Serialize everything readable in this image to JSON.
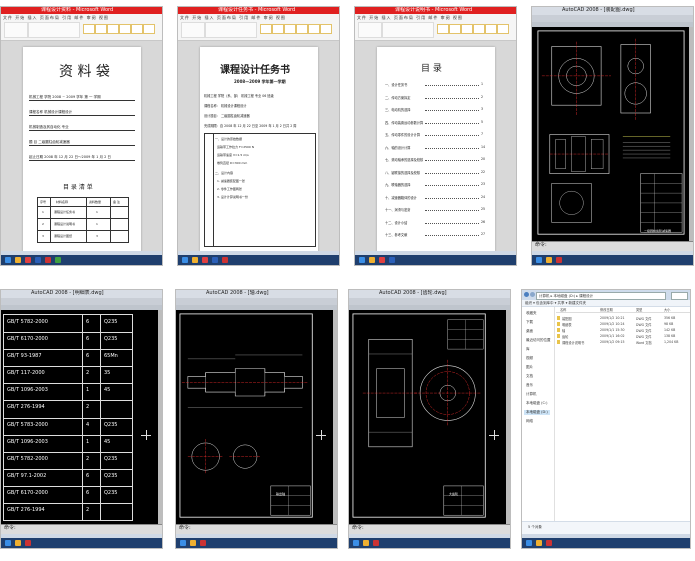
{
  "word_tiles": [
    {
      "window_title": "课程设计资料 - Microsoft Word",
      "ribbon_tabs": "文件 开始 插入 页面布局 引用 邮件 审阅 视图",
      "page": {
        "title": "资 料 袋",
        "lines": [
          "机械工程 学院 2008 ~ 2009 学年 第 一 学期",
          "课程名称 机械设计课程设计",
          "机械制造及其自动化 专业",
          "题 目 二级圆柱齿轮减速器",
          "起止日期 2008 年 12 月 22 日～2009 年 1 月 2 日"
        ],
        "subtitle": "目 录 清 单",
        "table_header": [
          "序号",
          "材料名称",
          "资料数量",
          "备 注"
        ],
        "table_rows": [
          [
            "1",
            "课程设计任务书",
            "1",
            ""
          ],
          [
            "2",
            "课程设计说明书",
            "1",
            ""
          ],
          [
            "3",
            "课程设计图纸",
            "3",
            ""
          ]
        ]
      }
    },
    {
      "window_title": "课程设计任务书 - Microsoft Word",
      "ribbon_tabs": "文件 开始 插入 页面布局 引用 邮件 审阅 视图",
      "page": {
        "title": "课程设计任务书",
        "subtitle": "2008—2009 学年第一学期",
        "lines": [
          "机械工程 学院（系、部） 机械工程 专业 06 班级",
          "课程名称： 机械设计课程设计",
          "设计题目： 二级圆柱齿轮减速器",
          "完成期限：自 2008 年 12 月 22 日至 2009 年 1 月 2 日共 2 周"
        ],
        "box_lines": [
          "一、设计的原始数据",
          "运输带工作拉力 F=2500 N",
          "运输带速度 V=1.5 m/s",
          "卷筒直径 D=300 mm",
          "二、设计内容",
          "1. 减速器装配图一张",
          "2. 零件工作图两张",
          "3. 设计计算说明书一份"
        ]
      }
    },
    {
      "window_title": "课程设计说明书 - Microsoft Word",
      "ribbon_tabs": "文件 开始 插入 页面布局 引用 邮件 审阅 视图",
      "page": {
        "title": "目 录",
        "toc": [
          {
            "label": "一、设计任务书",
            "page": "1"
          },
          {
            "label": "二、传动方案拟定",
            "page": "2"
          },
          {
            "label": "三、电动机的选择",
            "page": "3"
          },
          {
            "label": "四、传动装置运动参数计算",
            "page": "5"
          },
          {
            "label": "五、传动零件的设计计算",
            "page": "7"
          },
          {
            "label": "六、轴的设计计算",
            "page": "14"
          },
          {
            "label": "七、滚动轴承的选择及校核",
            "page": "20"
          },
          {
            "label": "八、键联接的选择及校核",
            "page": "22"
          },
          {
            "label": "九、联轴器的选择",
            "page": "23"
          },
          {
            "label": "十、减速器箱体的设计",
            "page": "24"
          },
          {
            "label": "十一、润滑与密封",
            "page": "25"
          },
          {
            "label": "十二、设计小结",
            "page": "26"
          },
          {
            "label": "十三、参考文献",
            "page": "27"
          }
        ]
      }
    }
  ],
  "cad_tiles": [
    {
      "window_title": "AutoCAD 2008 - [装配图.dwg]",
      "command": "命令:",
      "title_block": "二级圆柱齿轮减速器"
    },
    {
      "window_title": "AutoCAD 2008 - [明细表.dwg]",
      "command": "命令:",
      "parts_list": [
        "GB/T 5782-2000",
        "GB/T 6170-2000",
        "GB/T 93-1987",
        "GB/T 117-2000",
        "GB/T 1096-2003",
        "GB/T 276-1994",
        "GB/T 5783-2000",
        "GB/T 1096-2003",
        "GB/T 5782-2000",
        "GB/T 97.1-2002",
        "GB/T 6170-2000",
        "GB/T 276-1994"
      ],
      "parts_qty": [
        "6",
        "6",
        "6",
        "2",
        "1",
        "2",
        "4",
        "1",
        "2",
        "6",
        "6",
        "2"
      ],
      "parts_mat": [
        "Q235",
        "Q235",
        "65Mn",
        "35",
        "45",
        "",
        "Q235",
        "45",
        "Q235",
        "Q235",
        "Q235",
        ""
      ]
    },
    {
      "window_title": "AutoCAD 2008 - [轴.dwg]",
      "command": "命令:",
      "title_block": "输出轴"
    },
    {
      "window_title": "AutoCAD 2008 - [齿轮.dwg]",
      "command": "命令:",
      "title_block": "大齿轮"
    }
  ],
  "explorer": {
    "address": "计算机 ▸ 本地磁盘 (D:) ▸ 课程设计",
    "search_placeholder": "搜索",
    "toolbar": "组织 ▾   包含到库中 ▾   共享 ▾   新建文件夹",
    "nav": [
      "收藏夹",
      "下载",
      "桌面",
      "最近访问的位置",
      "库",
      "视频",
      "图片",
      "文档",
      "音乐",
      "计算机",
      "本地磁盘 (C:)",
      "本地磁盘 (D:)",
      "网络"
    ],
    "nav_selected_index": 11,
    "columns": [
      "名称",
      "修改日期",
      "类型",
      "大小"
    ],
    "files": [
      {
        "name": "装配图",
        "date": "2009/1/2 10:21",
        "type": "DWG 文件",
        "size": "356 KB"
      },
      {
        "name": "明细表",
        "date": "2009/1/2 10:24",
        "type": "DWG 文件",
        "size": "98 KB"
      },
      {
        "name": "轴",
        "date": "2009/1/1 15:30",
        "type": "DWG 文件",
        "size": "142 KB"
      },
      {
        "name": "齿轮",
        "date": "2009/1/1 16:02",
        "type": "DWG 文件",
        "size": "138 KB"
      },
      {
        "name": "课程设计说明书",
        "date": "2009/1/2 09:15",
        "type": "Word 文档",
        "size": "1,204 KB"
      }
    ],
    "status": "5 个对象"
  },
  "colors": {
    "word_title": "#e02020",
    "taskbar": "#1f3f6e",
    "cad_bg": "#000000",
    "cad_red": "#ff3030",
    "cad_yellow": "#ffff66"
  }
}
